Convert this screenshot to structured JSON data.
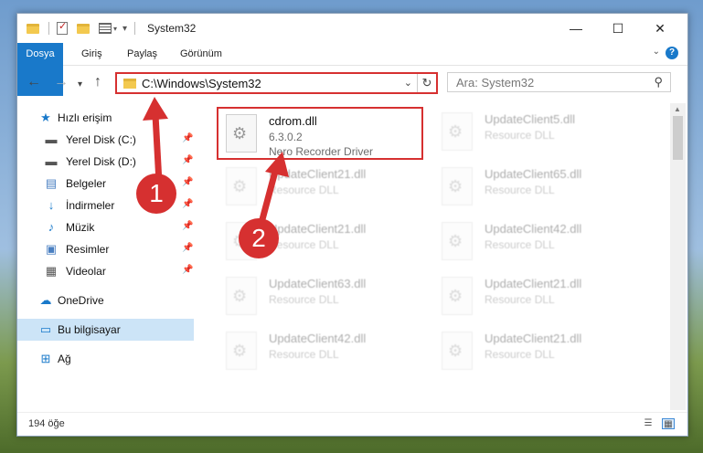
{
  "window": {
    "title": "System32"
  },
  "ribbon": {
    "tabs": [
      "Dosya",
      "Giriş",
      "Paylaş",
      "Görünüm"
    ]
  },
  "address": {
    "path": "C:\\Windows\\System32"
  },
  "search": {
    "placeholder": "Ara: System32"
  },
  "sidebar": {
    "quick_access": "Hızlı erişim",
    "items": [
      "Yerel Disk (C:)",
      "Yerel Disk (D:)",
      "Belgeler",
      "İndirmeler",
      "Müzik",
      "Resimler",
      "Videolar"
    ],
    "onedrive": "OneDrive",
    "this_pc": "Bu bilgisayar",
    "network": "Ağ"
  },
  "files": [
    {
      "name": "cdrom.dll",
      "version": "6.3.0.2",
      "description": "Nero Recorder Driver"
    },
    {
      "name": "UpdateClient5.dll",
      "description": "Resource DLL"
    },
    {
      "name": "UpdateClient21.dll",
      "description": "Resource DLL"
    },
    {
      "name": "UpdateClient65.dll",
      "description": "Resource DLL"
    },
    {
      "name": "UpdateClient21.dll",
      "description": "Resource DLL"
    },
    {
      "name": "UpdateClient42.dll",
      "description": "Resource DLL"
    },
    {
      "name": "UpdateClient63.dll",
      "description": "Resource DLL"
    },
    {
      "name": "UpdateClient21.dll",
      "description": "Resource DLL"
    },
    {
      "name": "UpdateClient42.dll",
      "description": "Resource DLL"
    },
    {
      "name": "UpdateClient21.dll",
      "description": "Resource DLL"
    }
  ],
  "status": {
    "count": "194 öğe"
  },
  "annotations": {
    "step1": "1",
    "step2": "2"
  },
  "colors": {
    "accent": "#1979ca",
    "highlight": "#d63030",
    "selection": "#cce4f7"
  }
}
